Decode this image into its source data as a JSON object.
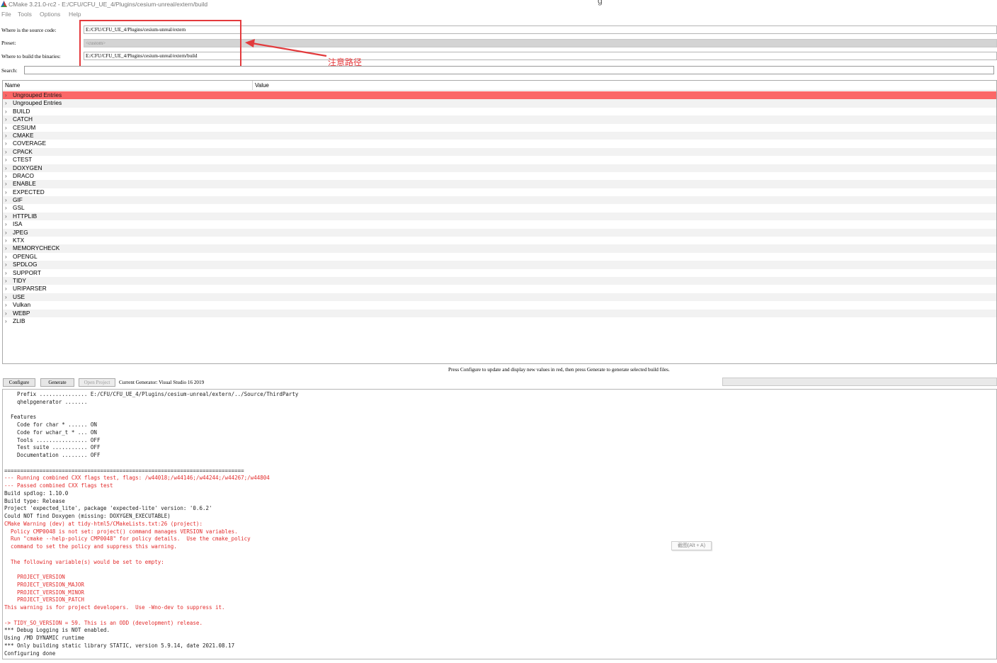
{
  "window": {
    "title": "CMake 3.21.0-rc2 - E:/CFU/CFU_UE_4/Plugins/cesium-unreal/extern/build",
    "title_overflow_glyph": "g"
  },
  "menu": {
    "items": [
      "File",
      "Tools",
      "Options",
      "Help"
    ]
  },
  "form": {
    "source_label": "Where is the source code:",
    "source_value": "E:/CFU/CFU_UE_4/Plugins/cesium-unreal/extern",
    "preset_label": "Preset:",
    "preset_value": "<custom>",
    "binaries_label": "Where to build the binaries:",
    "binaries_value": "E:/CFU/CFU_UE_4/Plugins/cesium-unreal/extern/build",
    "search_label": "Search:",
    "search_value": ""
  },
  "annotation": {
    "text": "注意路径",
    "color": "#e83d3f"
  },
  "tree": {
    "columns": [
      "Name",
      "Value"
    ],
    "rows": [
      "Ungrouped Entries",
      "Ungrouped Entries",
      "BUILD",
      "CATCH",
      "CESIUM",
      "CMAKE",
      "COVERAGE",
      "CPACK",
      "CTEST",
      "DOXYGEN",
      "DRACO",
      "ENABLE",
      "EXPECTED",
      "GIF",
      "GSL",
      "HTTPLIB",
      "ISA",
      "JPEG",
      "KTX",
      "MEMORYCHECK",
      "OPENGL",
      "SPDLOG",
      "SUPPORT",
      "TIDY",
      "URIPARSER",
      "USE",
      "Vulkan",
      "WEBP",
      "ZLIB"
    ],
    "selected_index": 0,
    "selected_color": "#fb6767"
  },
  "hint": "Press Configure to update and display new values in red, then press Generate to generate selected build files.",
  "buttons": {
    "configure": "Configure",
    "generate": "Generate",
    "open_project": "Open Project"
  },
  "generator": "Current Generator: Visual Studio 16 2019",
  "tooltip": "截图(Alt + A)",
  "console": {
    "lines": [
      {
        "text": "    Prefix ............... E:/CFU/CFU_UE_4/Plugins/cesium-unreal/extern/../Source/ThirdParty",
        "red": false
      },
      {
        "text": "    qhelpgenerator .......",
        "red": false
      },
      {
        "text": "",
        "red": false
      },
      {
        "text": "  Features",
        "red": false
      },
      {
        "text": "    Code for char * ...... ON",
        "red": false
      },
      {
        "text": "    Code for wchar_t * ... ON",
        "red": false
      },
      {
        "text": "    Tools ................ OFF",
        "red": false
      },
      {
        "text": "    Test suite ........... OFF",
        "red": false
      },
      {
        "text": "    Documentation ........ OFF",
        "red": false
      },
      {
        "text": "",
        "red": false
      },
      {
        "text": "===========================================================================",
        "red": false
      },
      {
        "text": "--- Running combined CXX flags test, flags: /w44018;/w44146;/w44244;/w44267;/w44804",
        "red": true
      },
      {
        "text": "--- Passed combined CXX flags test",
        "red": true
      },
      {
        "text": "Build spdlog: 1.10.0",
        "red": false
      },
      {
        "text": "Build type: Release",
        "red": false
      },
      {
        "text": "Project 'expected_lite', package 'expected-lite' version: '0.6.2'",
        "red": false
      },
      {
        "text": "Could NOT find Doxygen (missing: DOXYGEN_EXECUTABLE)",
        "red": false
      },
      {
        "text": "CMake Warning (dev) at tidy-html5/CMakeLists.txt:26 (project):",
        "red": true
      },
      {
        "text": "  Policy CMP0048 is not set: project() command manages VERSION variables.",
        "red": true
      },
      {
        "text": "  Run \"cmake --help-policy CMP0048\" for policy details.  Use the cmake_policy",
        "red": true
      },
      {
        "text": "  command to set the policy and suppress this warning.",
        "red": true
      },
      {
        "text": "",
        "red": true
      },
      {
        "text": "  The following variable(s) would be set to empty:",
        "red": true
      },
      {
        "text": "",
        "red": true
      },
      {
        "text": "    PROJECT_VERSION",
        "red": true
      },
      {
        "text": "    PROJECT_VERSION_MAJOR",
        "red": true
      },
      {
        "text": "    PROJECT_VERSION_MINOR",
        "red": true
      },
      {
        "text": "    PROJECT_VERSION_PATCH",
        "red": true
      },
      {
        "text": "This warning is for project developers.  Use -Wno-dev to suppress it.",
        "red": true
      },
      {
        "text": "",
        "red": false
      },
      {
        "text": "-> TIDY_SO_VERSION = 59. This is an ODD (development) release.",
        "red": true
      },
      {
        "text": "*** Debug Logging is NOT enabled.",
        "red": false
      },
      {
        "text": "Using /MD DYNAMIC runtime",
        "red": false
      },
      {
        "text": "*** Only building static library STATIC, version 5.9.14, date 2021.08.17",
        "red": false
      },
      {
        "text": "Configuring done",
        "red": false
      }
    ]
  }
}
